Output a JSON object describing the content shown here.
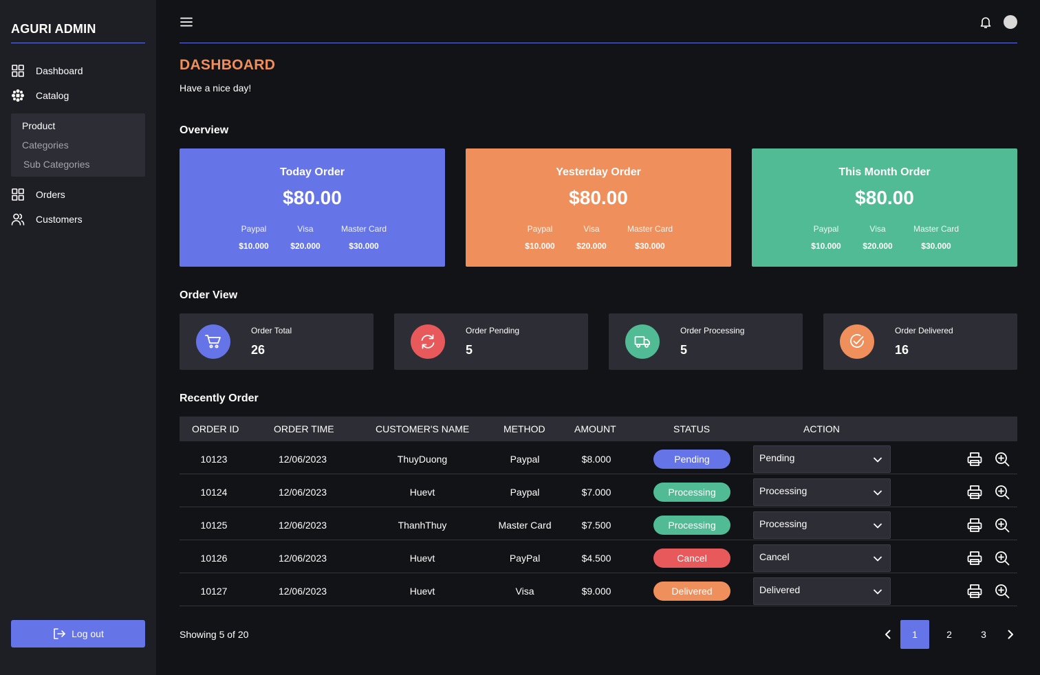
{
  "sidebar": {
    "brand": "AGURI ADMIN",
    "items": [
      {
        "label": "Dashboard",
        "icon": "grid-icon"
      },
      {
        "label": "Catalog",
        "icon": "catalog-icon"
      },
      {
        "label": "Orders",
        "icon": "grid-icon"
      },
      {
        "label": "Customers",
        "icon": "users-icon"
      }
    ],
    "submenu": [
      "Product",
      "Categories",
      "Sub Categories"
    ],
    "logout_label": "Log out"
  },
  "header": {
    "title": "DASHBOARD",
    "subtitle": "Have a nice day!"
  },
  "sections": {
    "overview": "Overview",
    "order_view": "Order View",
    "recent": "Recently Order"
  },
  "overview_cards": [
    {
      "title": "Today Order",
      "amount": "$80.00",
      "color": "#6575e8",
      "methods": [
        {
          "label": "Paypal",
          "value": "$10.000"
        },
        {
          "label": "Visa",
          "value": "$20.000"
        },
        {
          "label": "Master Card",
          "value": "$30.000"
        }
      ]
    },
    {
      "title": "Yesterday Order",
      "amount": "$80.00",
      "color": "#ef8f5b",
      "methods": [
        {
          "label": "Paypal",
          "value": "$10.000"
        },
        {
          "label": "Visa",
          "value": "$20.000"
        },
        {
          "label": "Master Card",
          "value": "$30.000"
        }
      ]
    },
    {
      "title": "This Month Order",
      "amount": "$80.00",
      "color": "#50bb94",
      "methods": [
        {
          "label": "Paypal",
          "value": "$10.000"
        },
        {
          "label": "Visa",
          "value": "$20.000"
        },
        {
          "label": "Master Card",
          "value": "$30.000"
        }
      ]
    }
  ],
  "order_view": [
    {
      "label": "Order Total",
      "count": "26",
      "color": "#6575e8",
      "icon": "cart-icon"
    },
    {
      "label": "Order Pending",
      "count": "5",
      "color": "#e8595b",
      "icon": "refresh-icon"
    },
    {
      "label": "Order Processing",
      "count": "5",
      "color": "#50bb94",
      "icon": "truck-icon"
    },
    {
      "label": "Order Delivered",
      "count": "16",
      "color": "#ef8f5b",
      "icon": "check-circle-icon"
    }
  ],
  "table": {
    "headers": [
      "ORDER ID",
      "ORDER TIME",
      "CUSTOMER'S NAME",
      "METHOD",
      "AMOUNT",
      "STATUS",
      "ACTION"
    ],
    "rows": [
      {
        "id": "10123",
        "time": "12/06/2023",
        "name": "ThuyDuong",
        "method": "Paypal",
        "amount": "$8.000",
        "status": "Pending",
        "status_color": "#6575e8",
        "select": "Pending"
      },
      {
        "id": "10124",
        "time": "12/06/2023",
        "name": "Huevt",
        "method": "Paypal",
        "amount": "$7.000",
        "status": "Processing",
        "status_color": "#50bb94",
        "select": "Processing"
      },
      {
        "id": "10125",
        "time": "12/06/2023",
        "name": "ThanhThuy",
        "method": "Master Card",
        "amount": "$7.500",
        "status": "Processing",
        "status_color": "#50bb94",
        "select": "Processing"
      },
      {
        "id": "10126",
        "time": "12/06/2023",
        "name": "Huevt",
        "method": "PayPal",
        "amount": "$4.500",
        "status": "Cancel",
        "status_color": "#e8595b",
        "select": "Cancel"
      },
      {
        "id": "10127",
        "time": "12/06/2023",
        "name": "Huevt",
        "method": "Visa",
        "amount": "$9.000",
        "status": "Delivered",
        "status_color": "#ef8f5b",
        "select": "Delivered"
      }
    ]
  },
  "footer": {
    "showing": "Showing 5 of 20",
    "pages": [
      "1",
      "2",
      "3"
    ],
    "active_page": "1",
    "accent": "#6575e8"
  }
}
